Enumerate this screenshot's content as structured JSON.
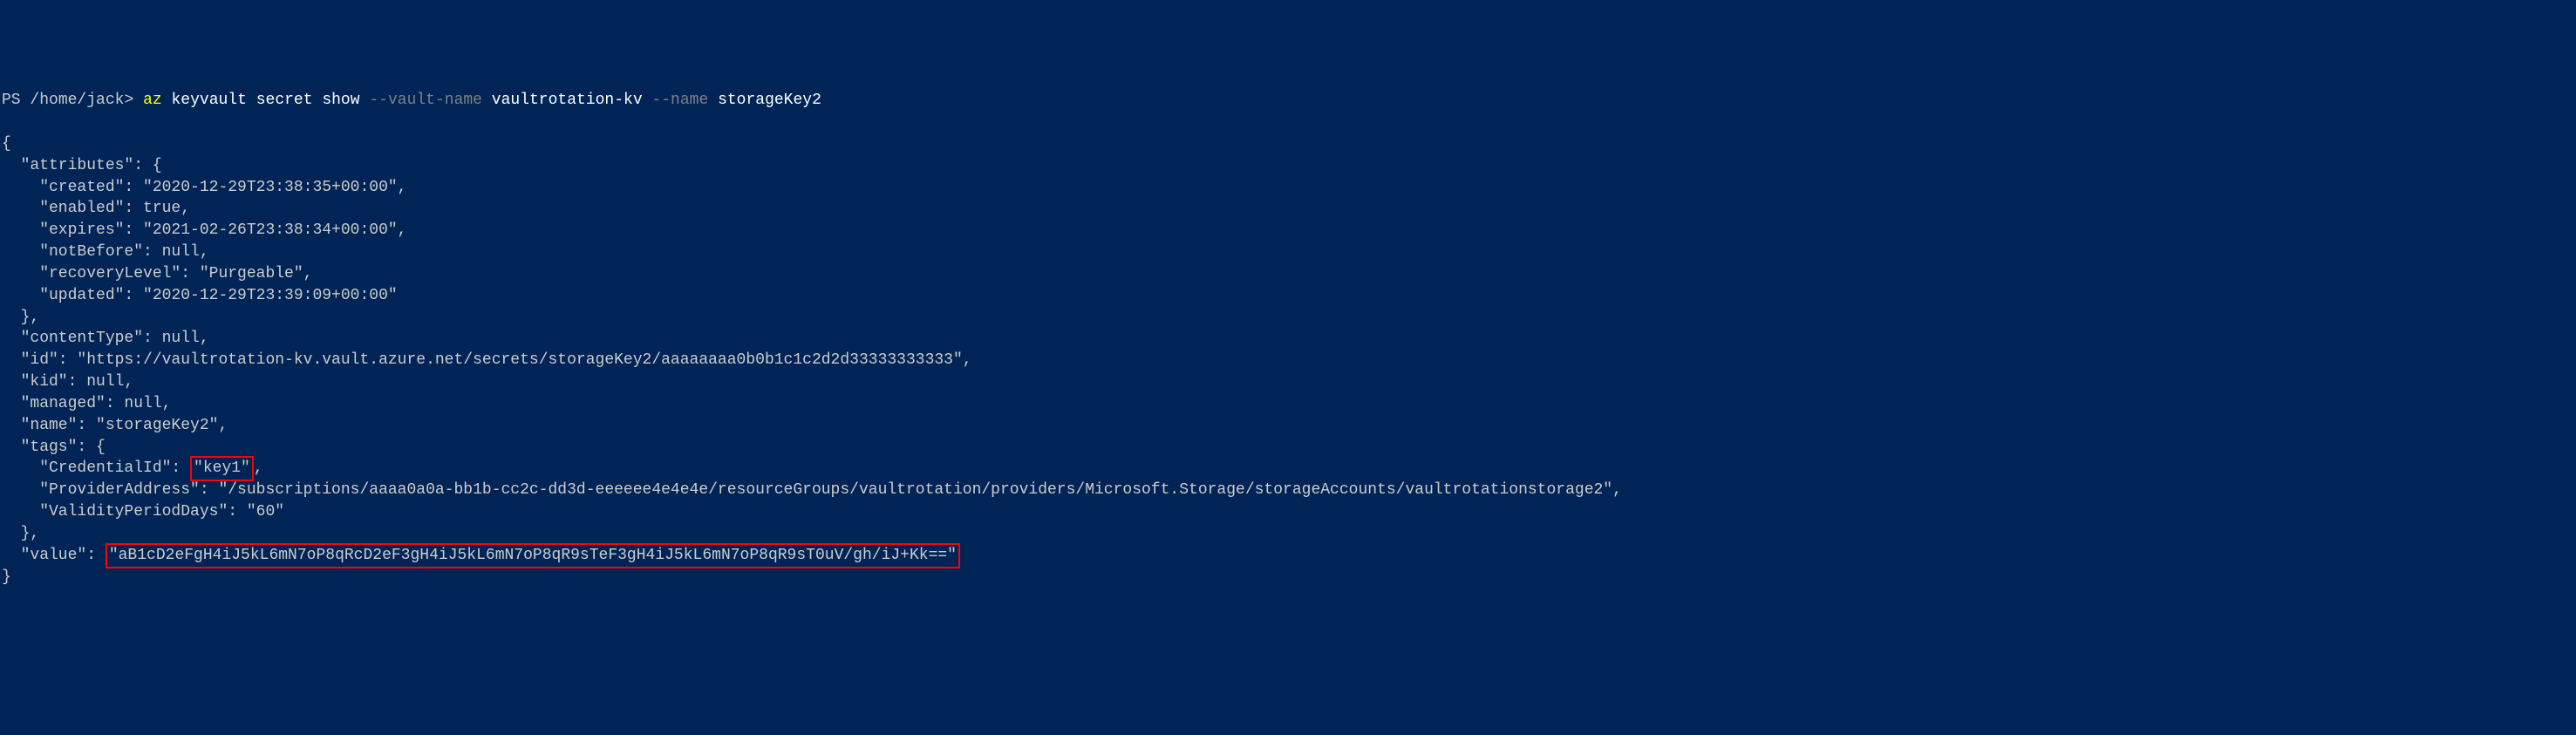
{
  "prompt": {
    "ps": "PS",
    "path": "/home/jack",
    "arrow": ">",
    "cmd": "az",
    "subcmd": "keyvault secret show",
    "flag1": "--vault-name",
    "val1": "vaultrotation-kv",
    "flag2": "--name",
    "val2": "storageKey2"
  },
  "json": {
    "open": "{",
    "attrs_key": "  \"attributes\": {",
    "created": "    \"created\": \"2020-12-29T23:38:35+00:00\",",
    "enabled": "    \"enabled\": true,",
    "expires": "    \"expires\": \"2021-02-26T23:38:34+00:00\",",
    "notBefore": "    \"notBefore\": null,",
    "recoveryLevel": "    \"recoveryLevel\": \"Purgeable\",",
    "updated": "    \"updated\": \"2020-12-29T23:39:09+00:00\"",
    "attrs_close": "  },",
    "contentType": "  \"contentType\": null,",
    "id": "  \"id\": \"https://vaultrotation-kv.vault.azure.net/secrets/storageKey2/aaaaaaaa0b0b1c1c2d2d33333333333\",",
    "kid": "  \"kid\": null,",
    "managed": "  \"managed\": null,",
    "name": "  \"name\": \"storageKey2\",",
    "tags_open": "  \"tags\": {",
    "credId_key": "    \"CredentialId\": ",
    "credId_val": "\"key1\"",
    "credId_comma": ",",
    "providerAddress": "    \"ProviderAddress\": \"/subscriptions/aaaa0a0a-bb1b-cc2c-dd3d-eeeeee4e4e4e/resourceGroups/vaultrotation/providers/Microsoft.Storage/storageAccounts/vaultrotationstorage2\",",
    "validityPeriod": "    \"ValidityPeriodDays\": \"60\"",
    "tags_close": "  },",
    "value_key": "  \"value\": ",
    "value_val": "\"aB1cD2eFgH4iJ5kL6mN7oP8qRcD2eF3gH4iJ5kL6mN7oP8qR9sTeF3gH4iJ5kL6mN7oP8qR9sT0uV/gh/iJ+Kk==\"",
    "close": "}"
  }
}
